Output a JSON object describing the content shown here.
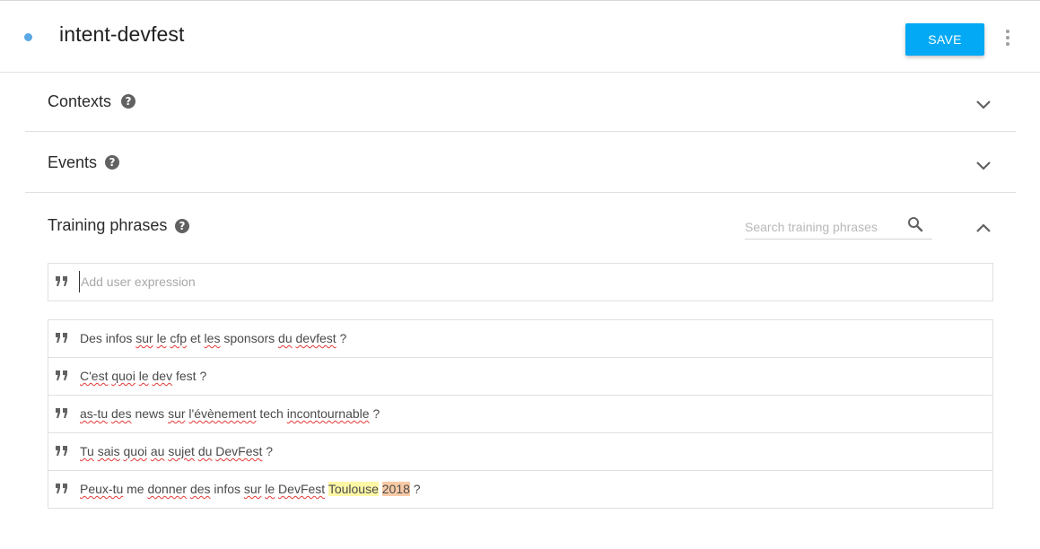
{
  "header": {
    "intent_name": "intent-devfest",
    "save_label": "SAVE",
    "status_color": "#5aa9e6",
    "accent_color": "#03a9f4"
  },
  "sections": {
    "contexts": {
      "title": "Contexts",
      "expanded": false
    },
    "events": {
      "title": "Events",
      "expanded": false
    },
    "training": {
      "title": "Training phrases",
      "expanded": true
    }
  },
  "search": {
    "placeholder": "Search training phrases",
    "value": ""
  },
  "add_expression": {
    "placeholder": "Add user expression",
    "value": ""
  },
  "icons": {
    "help": "help-circle-icon",
    "chevron_down": "chevron-down-icon",
    "chevron_up": "chevron-up-icon",
    "search": "search-icon",
    "quote": "quote-icon",
    "more": "more-vert-icon"
  },
  "highlight_colors": {
    "yellow": "#fdf7a6",
    "orange": "#f9caa6"
  },
  "phrases": [
    {
      "text": "Des infos sur le cfp et les sponsors du devfest ?",
      "segments": [
        {
          "t": "Des infos "
        },
        {
          "t": "sur",
          "spell": true
        },
        {
          "t": " "
        },
        {
          "t": "le",
          "spell": true
        },
        {
          "t": " "
        },
        {
          "t": "cfp",
          "spell": true
        },
        {
          "t": " et "
        },
        {
          "t": "les",
          "spell": true
        },
        {
          "t": " sponsors "
        },
        {
          "t": "du",
          "spell": true
        },
        {
          "t": " "
        },
        {
          "t": "devfest",
          "spell": true
        },
        {
          "t": " ?"
        }
      ]
    },
    {
      "text": "C'est quoi le dev fest ?",
      "segments": [
        {
          "t": "C'est",
          "spell": true
        },
        {
          "t": " "
        },
        {
          "t": "quoi",
          "spell": true
        },
        {
          "t": " "
        },
        {
          "t": "le",
          "spell": true
        },
        {
          "t": " "
        },
        {
          "t": "dev",
          "spell": true
        },
        {
          "t": " fest ?"
        }
      ]
    },
    {
      "text": "as-tu des news sur l'évènement tech incontournable ?",
      "segments": [
        {
          "t": "as-tu",
          "spell": true
        },
        {
          "t": " "
        },
        {
          "t": "des",
          "spell": true
        },
        {
          "t": " news "
        },
        {
          "t": "sur",
          "spell": true
        },
        {
          "t": " "
        },
        {
          "t": "l'évènement",
          "spell": true
        },
        {
          "t": " tech "
        },
        {
          "t": "incontournable",
          "spell": true
        },
        {
          "t": " ?"
        }
      ]
    },
    {
      "text": "Tu sais quoi au sujet du DevFest ?",
      "segments": [
        {
          "t": "Tu",
          "spell": true
        },
        {
          "t": " "
        },
        {
          "t": "sais",
          "spell": true
        },
        {
          "t": " "
        },
        {
          "t": "quoi",
          "spell": true
        },
        {
          "t": " "
        },
        {
          "t": "au",
          "spell": true
        },
        {
          "t": " "
        },
        {
          "t": "sujet",
          "spell": true
        },
        {
          "t": " "
        },
        {
          "t": "du",
          "spell": true
        },
        {
          "t": " "
        },
        {
          "t": "DevFest",
          "spell": true
        },
        {
          "t": " ?"
        }
      ]
    },
    {
      "text": "Peux-tu me donner des infos sur le DevFest Toulouse 2018 ?",
      "segments": [
        {
          "t": "Peux-tu",
          "spell": true
        },
        {
          "t": " me "
        },
        {
          "t": "donner",
          "spell": true
        },
        {
          "t": " "
        },
        {
          "t": "des",
          "spell": true
        },
        {
          "t": " infos "
        },
        {
          "t": "sur",
          "spell": true
        },
        {
          "t": " "
        },
        {
          "t": "le",
          "spell": true
        },
        {
          "t": " "
        },
        {
          "t": "DevFest",
          "spell": true
        },
        {
          "t": " "
        },
        {
          "t": "Toulouse",
          "hl": "yellow"
        },
        {
          "t": " "
        },
        {
          "t": "2018",
          "hl": "orange"
        },
        {
          "t": " ?"
        }
      ]
    }
  ]
}
